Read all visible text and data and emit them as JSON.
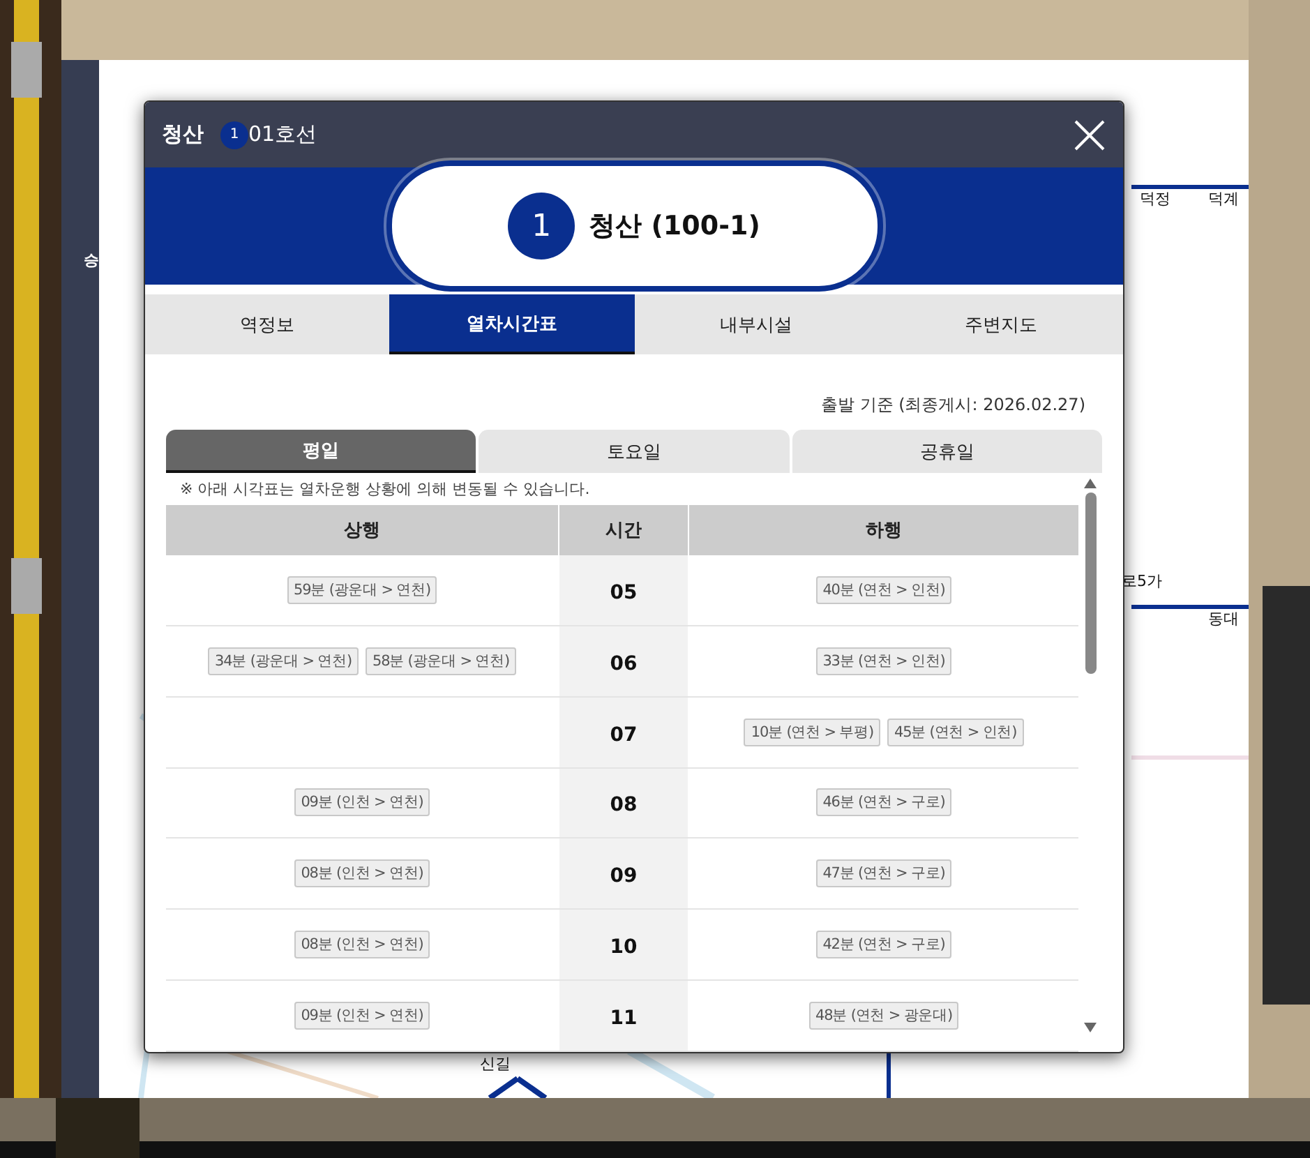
{
  "map_page": {
    "sidebar_label": "승",
    "labels": [
      {
        "text": "덕정"
      },
      {
        "text": "덕계"
      },
      {
        "text": "로5가"
      },
      {
        "text": "동대"
      },
      {
        "text": "신길"
      }
    ]
  },
  "modal": {
    "title": "청산",
    "line_badge": "1",
    "line_name": "01호선",
    "station": {
      "line_number": "1",
      "name": "청산 (100-1)"
    },
    "tabs": [
      {
        "label": "역정보",
        "selected": false
      },
      {
        "label": "열차시간표",
        "selected": true
      },
      {
        "label": "내부시설",
        "selected": false
      },
      {
        "label": "주변지도",
        "selected": false
      }
    ],
    "basis": "출발 기준 (최종게시: 2026.02.27)",
    "day_tabs": [
      {
        "label": "평일",
        "selected": true
      },
      {
        "label": "토요일",
        "selected": false
      },
      {
        "label": "공휴일",
        "selected": false
      }
    ],
    "notice": "※ 아래 시각표는 열차운행 상황에 의해 변동될 수 있습니다.",
    "table": {
      "columns": [
        "상행",
        "시간",
        "하행"
      ],
      "rows": [
        {
          "hour": "05",
          "up": [
            "59분 (광운대 > 연천)"
          ],
          "down": [
            "40분 (연천 > 인천)"
          ]
        },
        {
          "hour": "06",
          "up": [
            "34분 (광운대 > 연천)",
            "58분 (광운대 > 연천)"
          ],
          "down": [
            "33분 (연천 > 인천)"
          ]
        },
        {
          "hour": "07",
          "up": [],
          "down": [
            "10분 (연천 > 부평)",
            "45분 (연천 > 인천)"
          ]
        },
        {
          "hour": "08",
          "up": [
            "09분 (인천 > 연천)"
          ],
          "down": [
            "46분 (연천 > 구로)"
          ]
        },
        {
          "hour": "09",
          "up": [
            "08분 (인천 > 연천)"
          ],
          "down": [
            "47분 (연천 > 구로)"
          ]
        },
        {
          "hour": "10",
          "up": [
            "08분 (인천 > 연천)"
          ],
          "down": [
            "42분 (연천 > 구로)"
          ]
        },
        {
          "hour": "11",
          "up": [
            "09분 (인천 > 연천)"
          ],
          "down": [
            "48분 (연천 > 광운대)"
          ]
        }
      ]
    }
  }
}
